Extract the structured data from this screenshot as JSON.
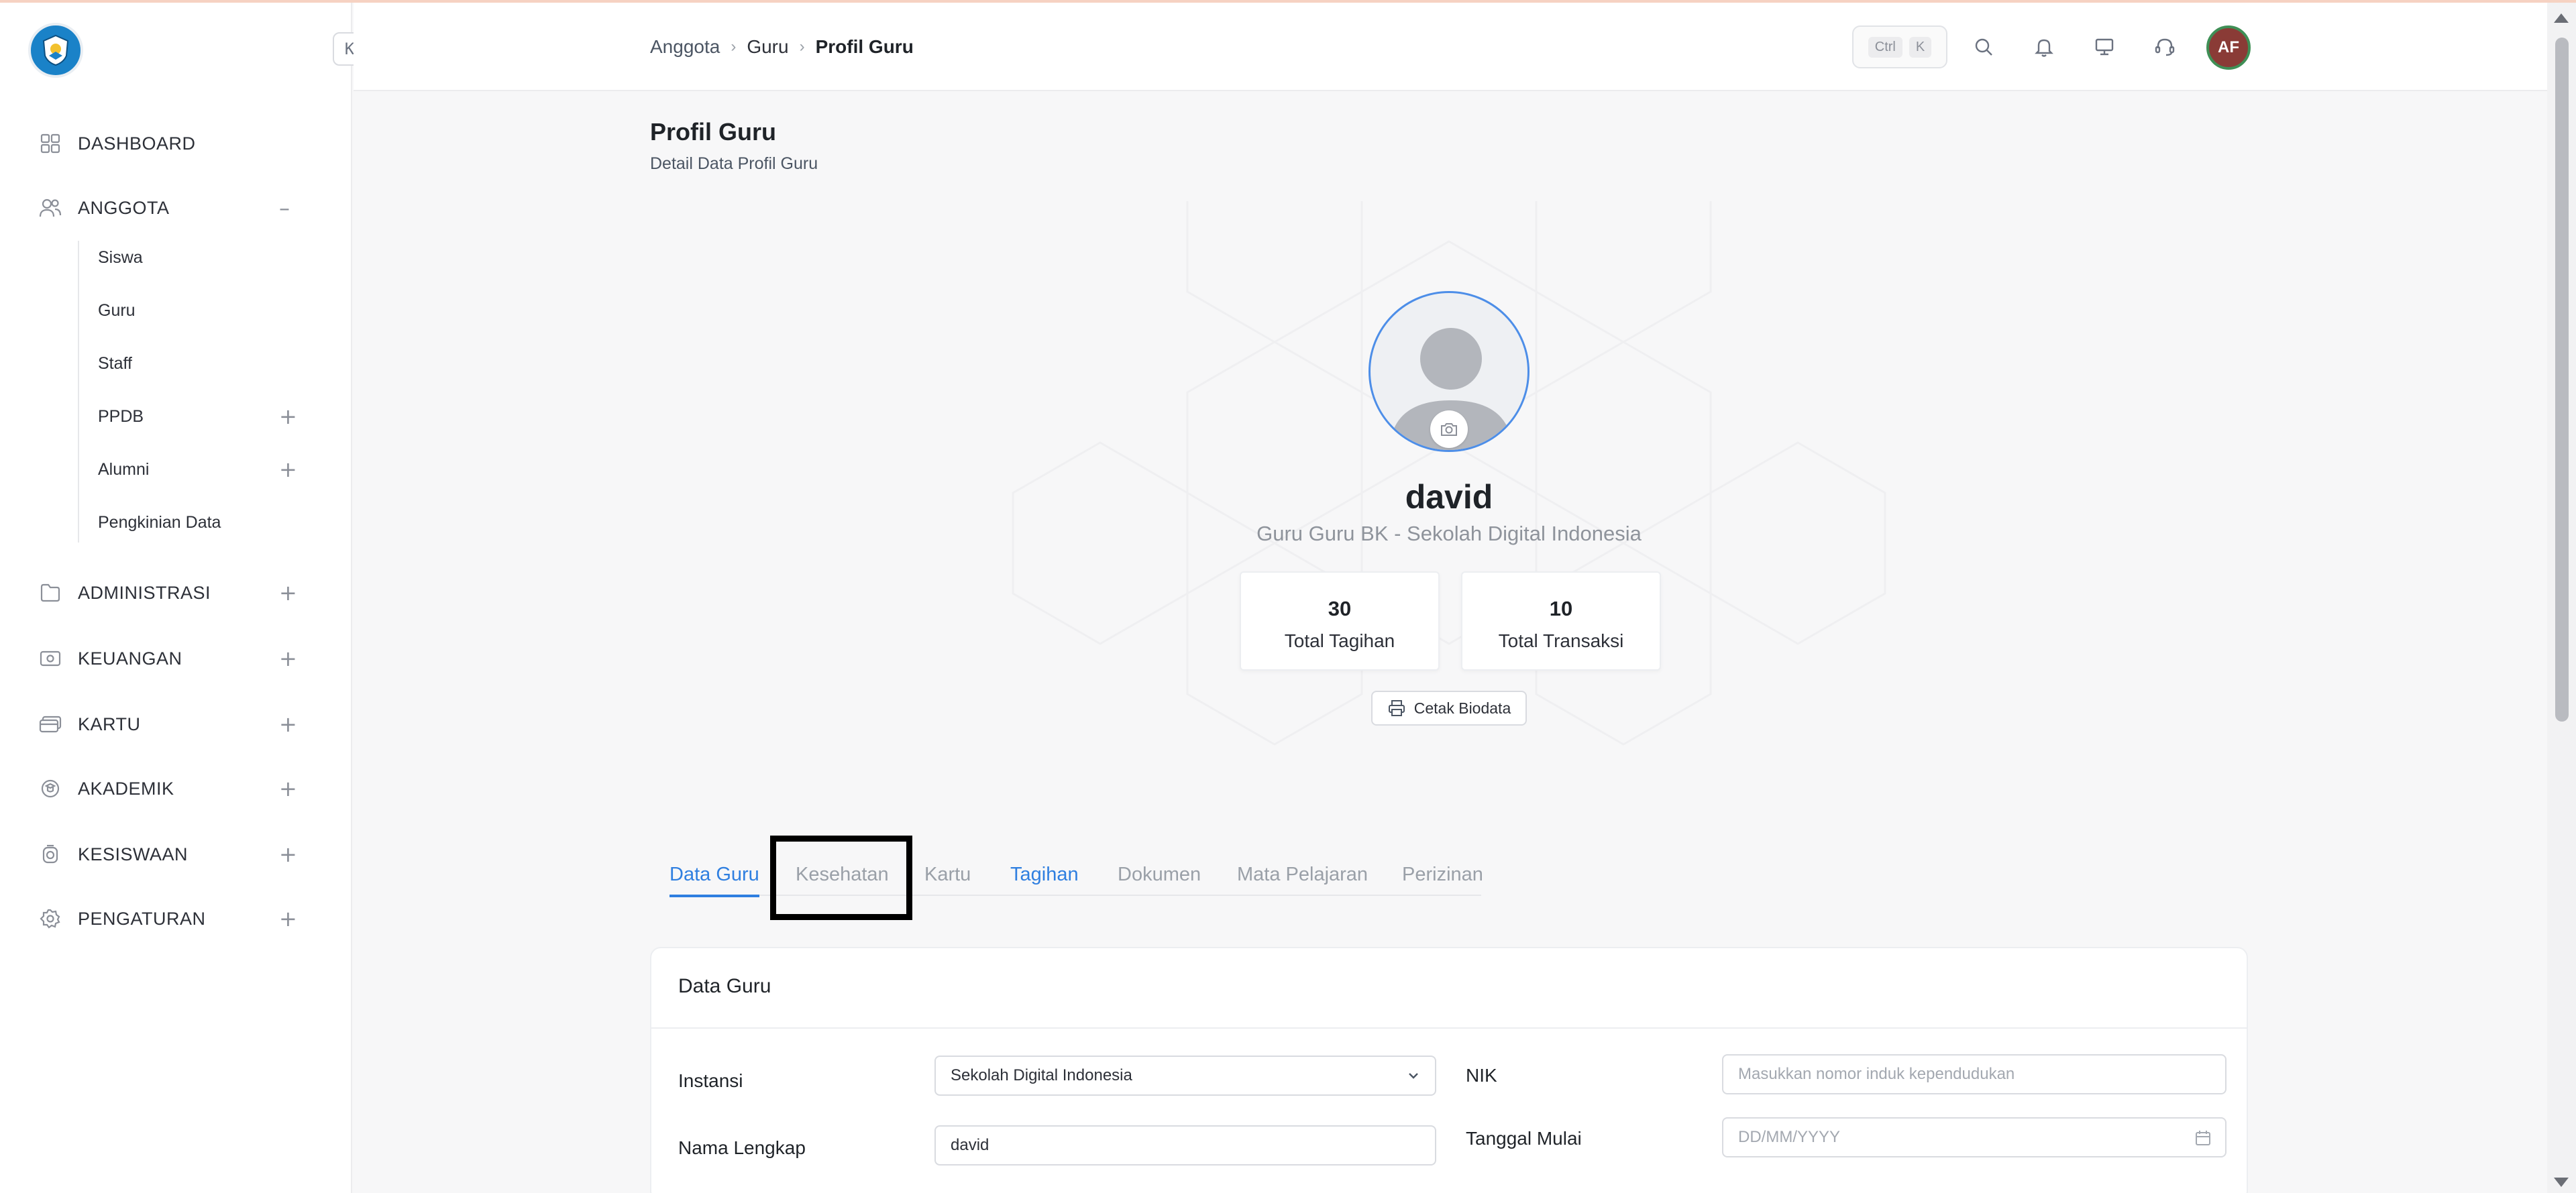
{
  "sidebar": {
    "collapse_glyph": "K",
    "items": [
      {
        "label": "DASHBOARD",
        "icon": "grid-icon"
      },
      {
        "label": "ANGGOTA",
        "icon": "users-icon",
        "toggle": "–"
      },
      {
        "label": "ADMINISTRASI",
        "icon": "folder-icon",
        "toggle": "+"
      },
      {
        "label": "KEUANGAN",
        "icon": "money-icon",
        "toggle": "+"
      },
      {
        "label": "KARTU",
        "icon": "card-icon",
        "toggle": "+"
      },
      {
        "label": "AKADEMIK",
        "icon": "academic-icon",
        "toggle": "+"
      },
      {
        "label": "KESISWAAN",
        "icon": "student-icon",
        "toggle": "+"
      },
      {
        "label": "PENGATURAN",
        "icon": "gear-icon",
        "toggle": "+"
      }
    ],
    "sub_items": [
      {
        "label": "Siswa"
      },
      {
        "label": "Guru"
      },
      {
        "label": "Staff"
      },
      {
        "label": "PPDB",
        "toggle": "+"
      },
      {
        "label": "Alumni",
        "toggle": "+"
      },
      {
        "label": "Pengkinian Data"
      }
    ]
  },
  "header": {
    "breadcrumb": [
      "Anggota",
      "Guru",
      "Profil Guru"
    ],
    "shortcut": [
      "Ctrl",
      "K"
    ],
    "avatar_initials": "AF"
  },
  "page": {
    "title": "Profil Guru",
    "subtitle": "Detail Data Profil Guru"
  },
  "profile": {
    "name": "david",
    "role": "Guru Guru BK - Sekolah Digital Indonesia",
    "stats": [
      {
        "value": "30",
        "label": "Total Tagihan"
      },
      {
        "value": "10",
        "label": "Total Transaksi"
      }
    ],
    "print_label": "Cetak Biodata"
  },
  "tabs": [
    "Data Guru",
    "Kesehatan",
    "Kartu",
    "Tagihan",
    "Dokumen",
    "Mata Pelajaran",
    "Perizinan"
  ],
  "form": {
    "title": "Data Guru",
    "instansi_label": "Instansi",
    "instansi_value": "Sekolah Digital Indonesia",
    "nama_label": "Nama Lengkap",
    "nama_value": "david",
    "nik_label": "NIK",
    "nik_placeholder": "Masukkan nomor induk kependudukan",
    "tanggal_label": "Tanggal Mulai",
    "tanggal_placeholder": "DD/MM/YYYY"
  },
  "colors": {
    "accent": "#2f7fe0",
    "logo": "#1a82c8",
    "avatar_bg": "#8a3b36",
    "avatar_ring": "#3f8f56"
  }
}
